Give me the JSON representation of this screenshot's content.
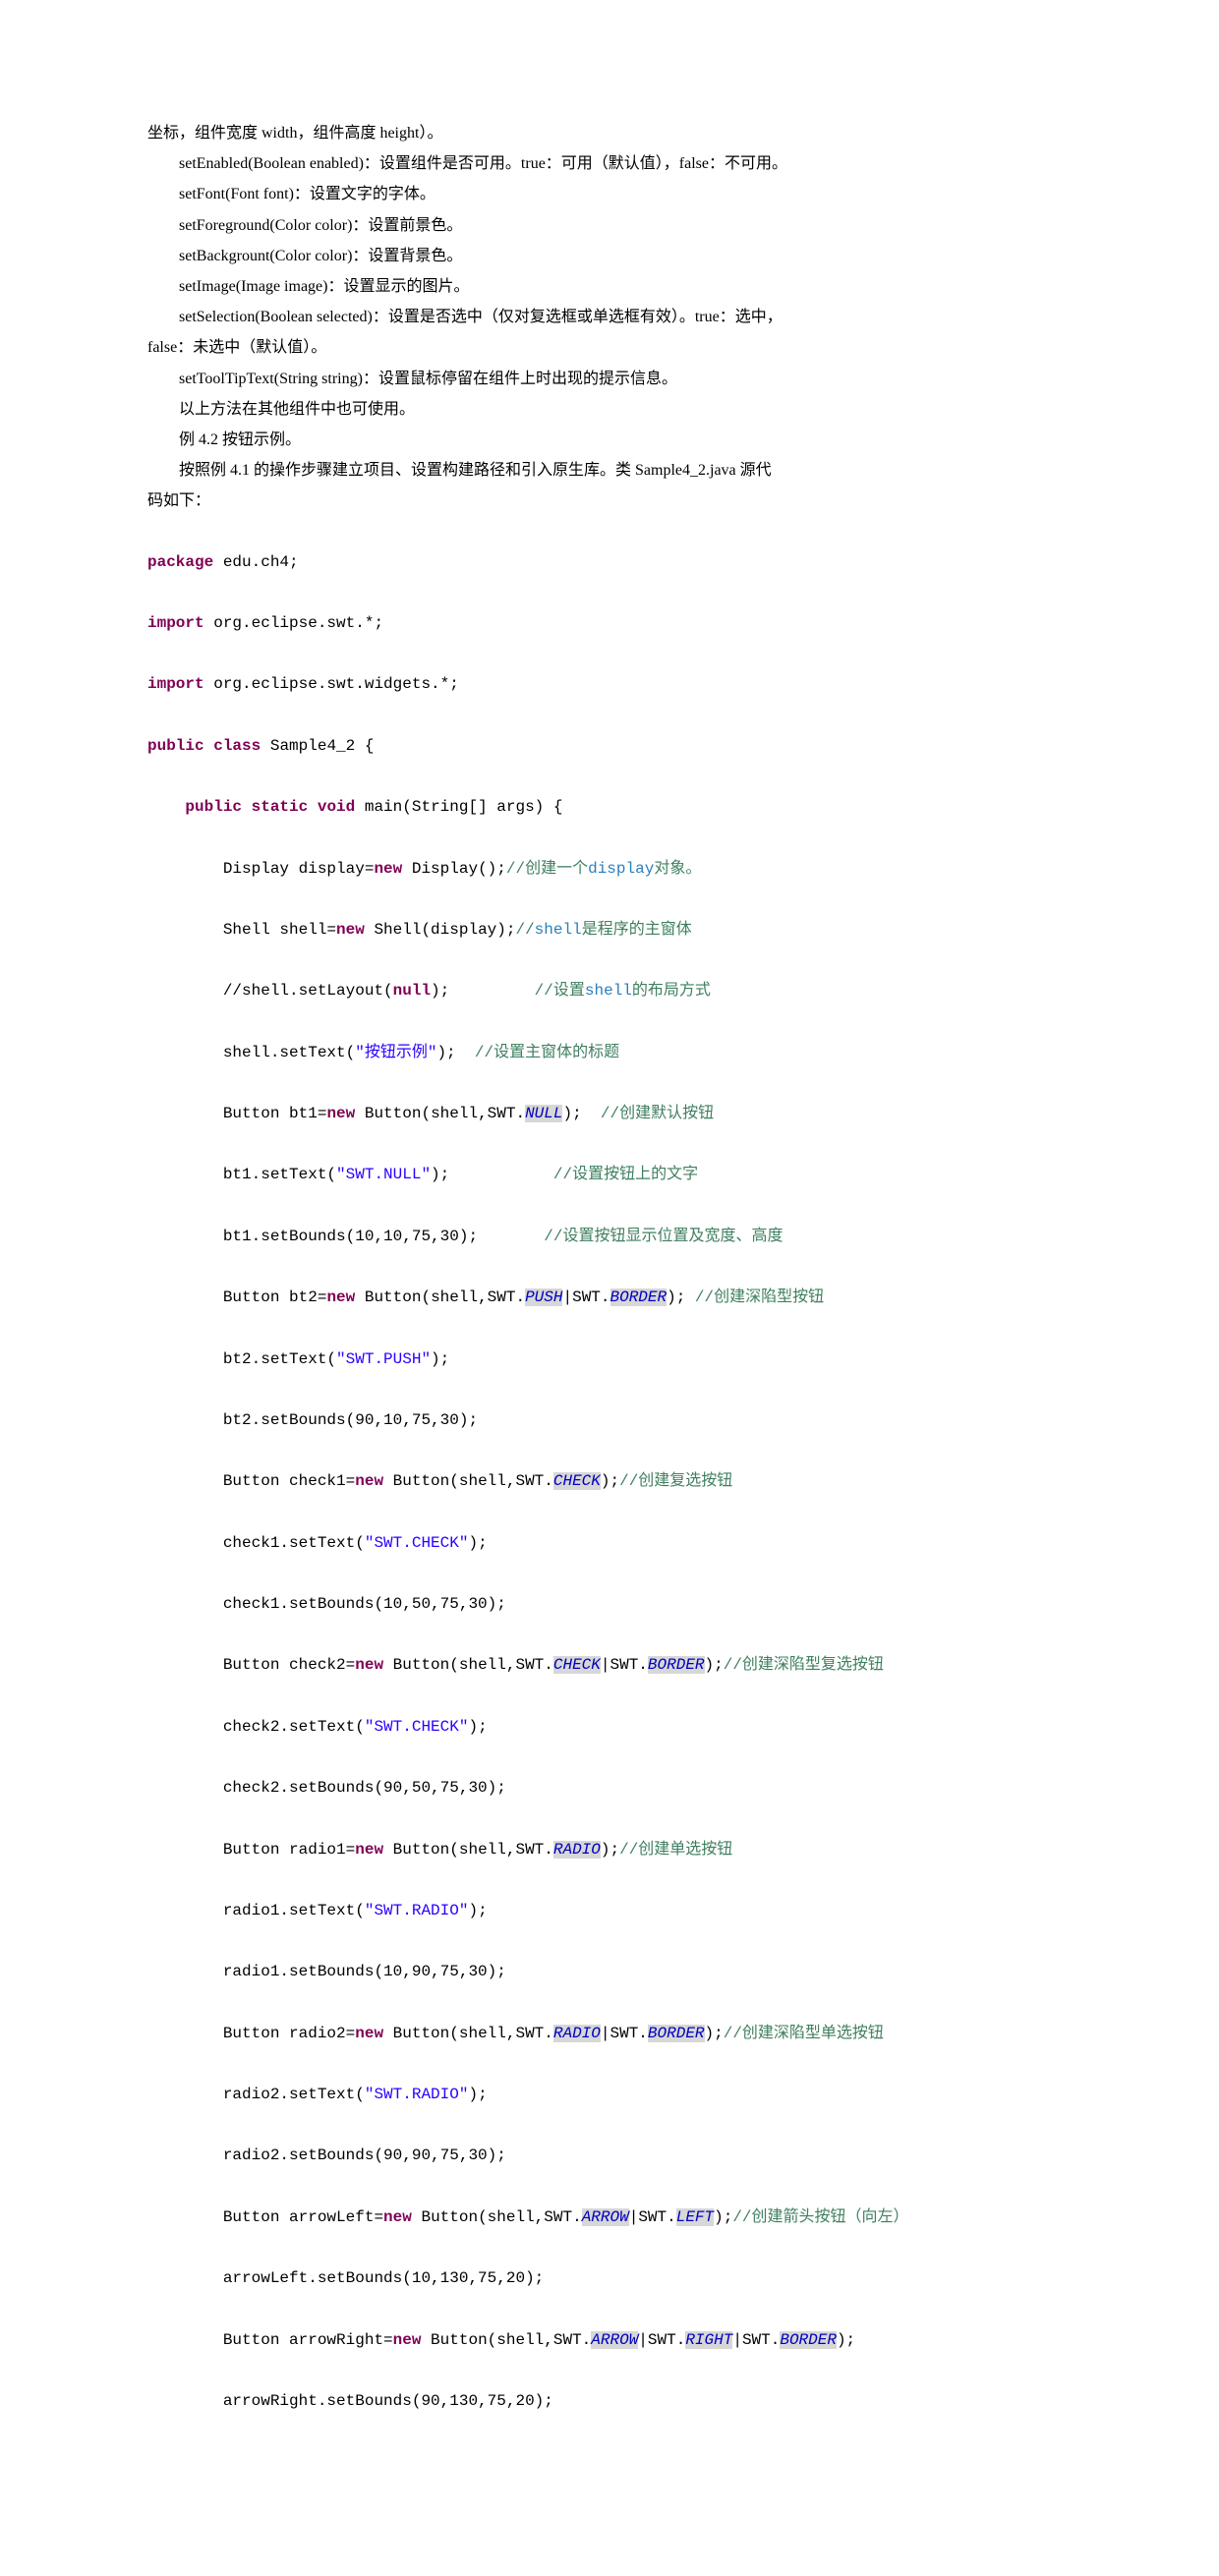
{
  "prose": {
    "p0": "坐标，组件宽度 width，组件高度 height）。",
    "p1": "setEnabled(Boolean enabled)：设置组件是否可用。true：可用（默认值），false：不可用。",
    "p2": "setFont(Font font)：设置文字的字体。",
    "p3": "setForeground(Color color)：设置前景色。",
    "p4": "setBackgrount(Color color)：设置背景色。",
    "p5": "setImage(Image image)：设置显示的图片。",
    "p6a": "setSelection(Boolean selected)：设置是否选中（仅对复选框或单选框有效）。true：选中，",
    "p6b": "false：未选中（默认值）。",
    "p7": "setToolTipText(String string)：设置鼠标停留在组件上时出现的提示信息。",
    "p8": "以上方法在其他组件中也可使用。",
    "p9": "例 4.2  按钮示例。",
    "p10a": "按照例 4.1 的操作步骤建立项目、设置构建路径和引入原生库。类 Sample4_2.java 源代",
    "p10b": "码如下："
  },
  "code": {
    "kw_package": "package",
    "pkg_name": " edu.ch4;",
    "kw_import": "import",
    "imp1": " org.eclipse.swt.*;",
    "imp2": " org.eclipse.swt.widgets.*;",
    "kw_public": "public",
    "kw_class": "class",
    "cls_name": " Sample4_2 {",
    "kw_static": "static",
    "kw_void": "void",
    "main_sig": " main(String[] args) {",
    "kw_new": "new",
    "kw_null": "null",
    "disp1": "        Display display=",
    "disp2": " Display();",
    "c_disp_a": "//创建一个",
    "c_disp_b": "display",
    "c_disp_c": "对象。",
    "shell1": "        Shell shell=",
    "shell2": " Shell(display);",
    "c_shell_a": "//",
    "c_shell_b": "shell",
    "c_shell_c": "是程序的主窗体",
    "layout1": "        //shell.setLayout(",
    "layout2": ");         ",
    "c_layout_a": "//设置",
    "c_layout_b": "shell",
    "c_layout_c": "的布局方式",
    "settext1": "        shell.setText(",
    "str_title": "\"按钮示例\"",
    "settext2": ");  ",
    "c_title": "//设置主窗体的标题",
    "bt1a": "        Button bt1=",
    "bt1b": " Button(shell,SWT.",
    "cst_null": "NULL",
    "bt1c": ");  ",
    "c_bt1": "//创建默认按钮",
    "bt1t1": "        bt1.setText(",
    "str_swtnull": "\"SWT.NULL\"",
    "bt1t2": ");           ",
    "c_bt1t": "//设置按钮上的文字",
    "bt1b1": "        bt1.setBounds(10,10,75,30);       ",
    "c_bt1b": "//设置按钮显示位置及宽度、高度",
    "bt2a": "        Button bt2=",
    "bt2b": " Button(shell,SWT.",
    "cst_push": "PUSH",
    "pipe": "|",
    "swtpre": "SWT.",
    "cst_border": "BORDER",
    "bt2c": "); ",
    "c_bt2": "//创建深陷型按钮",
    "bt2t1": "        bt2.setText(",
    "str_swtpush": "\"SWT.PUSH\"",
    "bt2t2": ");",
    "bt2b1": "        bt2.setBounds(90,10,75,30);",
    "ck1a": "        Button check1=",
    "ck1b": " Button(shell,SWT.",
    "cst_check": "CHECK",
    "ck1c": ");",
    "c_ck1": "//创建复选按钮",
    "ck1t1": "        check1.setText(",
    "str_swtcheck": "\"SWT.CHECK\"",
    "ck1t2": ");",
    "ck1b1": "        check1.setBounds(10,50,75,30);",
    "ck2a": "        Button check2=",
    "ck2b": " Button(shell,SWT.",
    "ck2c": ");",
    "c_ck2": "//创建深陷型复选按钮",
    "ck2t1": "        check2.setText(",
    "ck2t2": ");",
    "ck2b1": "        check2.setBounds(90,50,75,30);",
    "r1a": "        Button radio1=",
    "r1b": " Button(shell,SWT.",
    "cst_radio": "RADIO",
    "r1c": ");",
    "c_r1": "//创建单选按钮",
    "r1t1": "        radio1.setText(",
    "str_swtradio": "\"SWT.RADIO\"",
    "r1t2": ");",
    "r1b1": "        radio1.setBounds(10,90,75,30);",
    "r2a": "        Button radio2=",
    "r2b": " Button(shell,SWT.",
    "r2c": ");",
    "c_r2": "//创建深陷型单选按钮",
    "r2t1": "        radio2.setText(",
    "r2t2": ");",
    "r2b1": "        radio2.setBounds(90,90,75,30);",
    "al1": "        Button arrowLeft=",
    "al2": " Button(shell,SWT.",
    "cst_arrow": "ARROW",
    "cst_left": "LEFT",
    "al3": ");",
    "c_al": "//创建箭头按钮（向左）",
    "alb": "        arrowLeft.setBounds(10,130,75,20);",
    "ar1": "        Button arrowRight=",
    "ar2": " Button(shell,SWT.",
    "cst_right": "RIGHT",
    "ar3": ");",
    "arb": "        arrowRight.setBounds(90,130,75,20);"
  }
}
